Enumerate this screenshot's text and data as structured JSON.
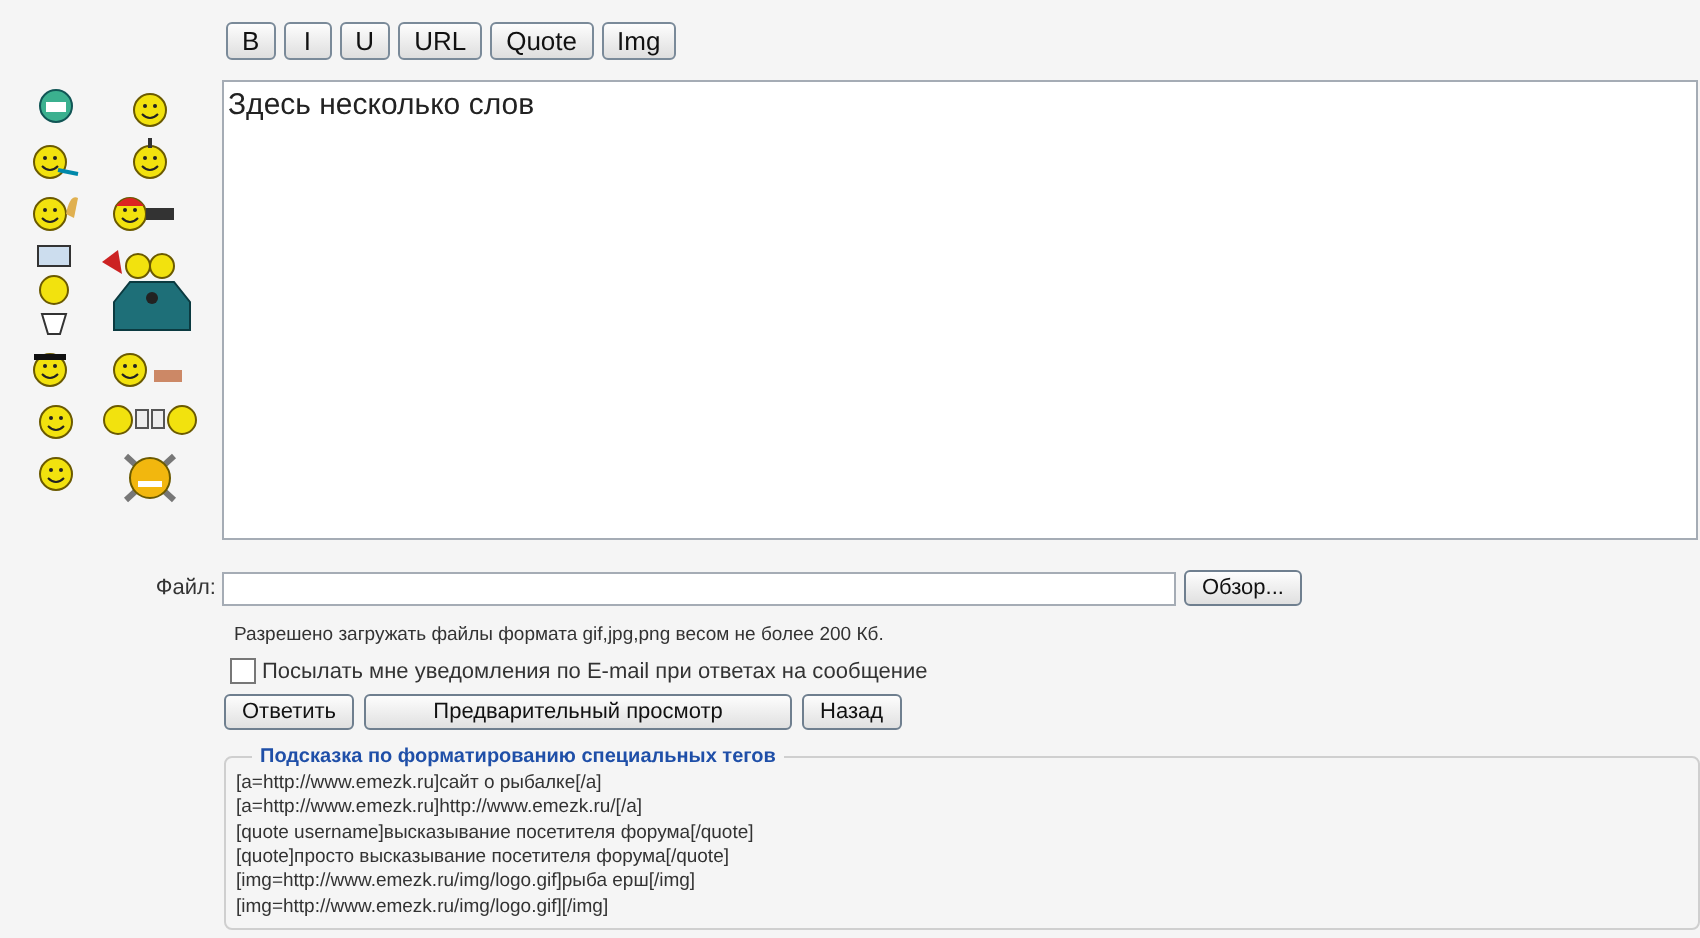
{
  "toolbar": [
    "B",
    "I",
    "U",
    "URL",
    "Quote",
    "Img"
  ],
  "message": {
    "value": "Здесь несколько слов"
  },
  "file": {
    "label": "Файл:",
    "browse": "Обзор..."
  },
  "hint": "Разрешено загружать файлы формата gif,jpg,png весом не более 200 Кб.",
  "notify": {
    "label": "Посылать мне уведомления по E-mail при ответах на сообщение",
    "checked": false
  },
  "actions": [
    "Ответить",
    "Предварительный просмотр",
    "Назад"
  ],
  "help": {
    "title": "Подсказка по форматированию специальных тегов",
    "lines": [
      "[a=http://www.emezk.ru]сайт о рыбалке[/a]",
      "[a=http://www.emezk.ru]http://www.emezk.ru/[/a]",
      "[quote username]высказывание посетителя форума[/quote]",
      "[quote]просто высказывание посетителя форума[/quote]",
      "[img=http://www.emezk.ru/img/logo.gif]рыба ерш[/img]",
      "[img=http://www.emezk.ru/img/logo.gif][/img]"
    ]
  }
}
